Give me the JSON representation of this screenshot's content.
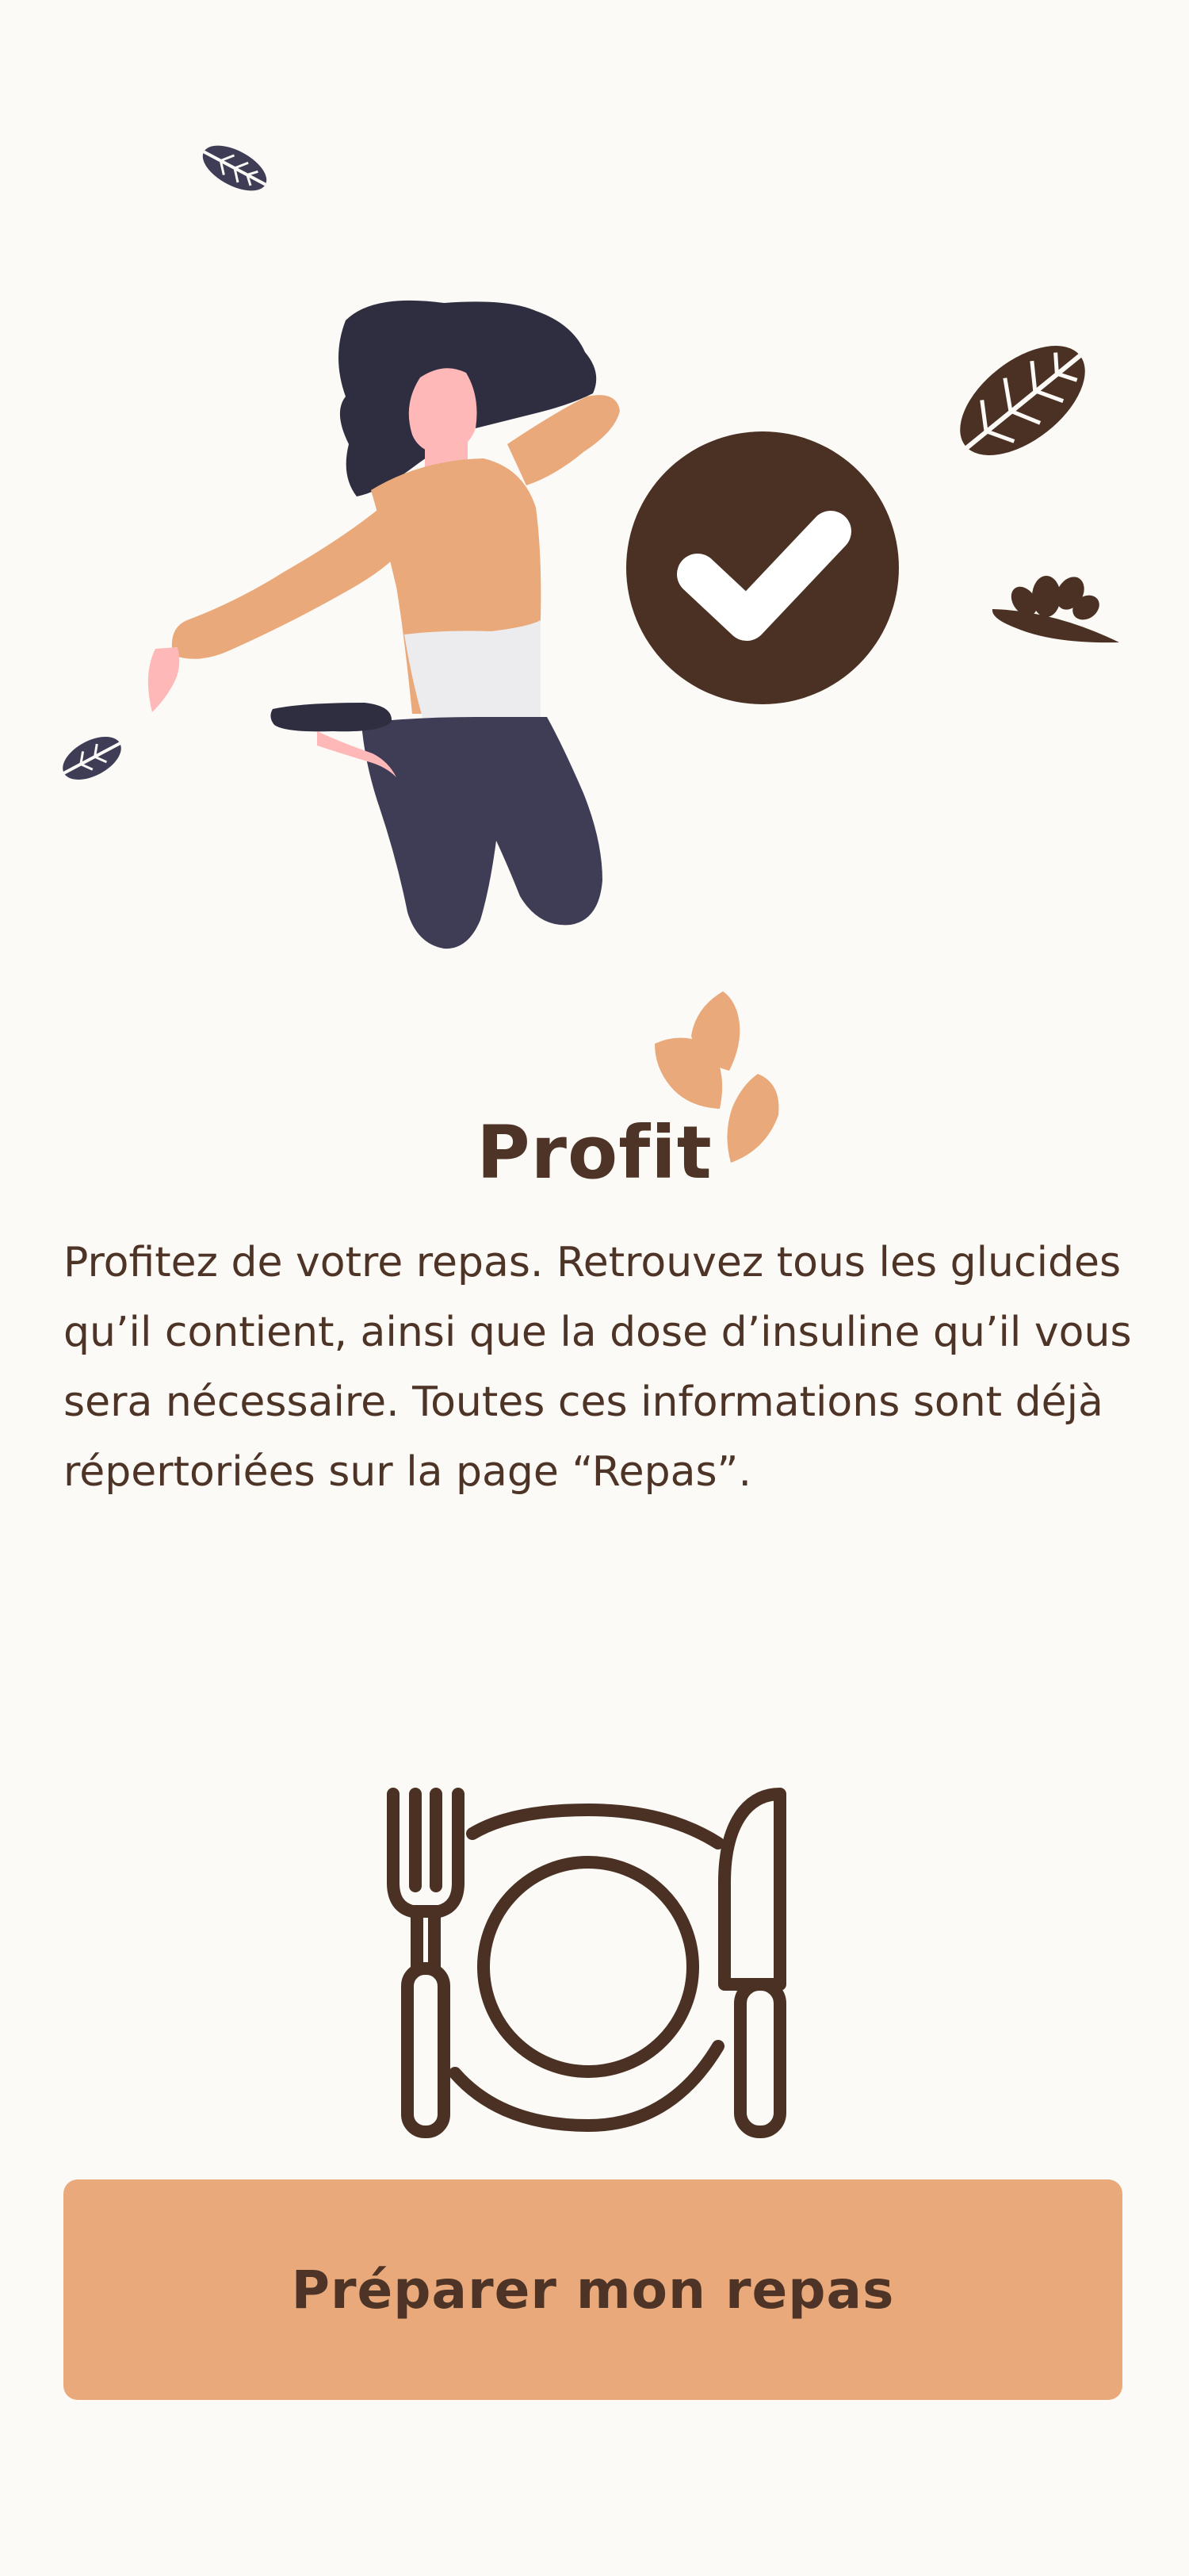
{
  "onboarding": {
    "title": "Profit",
    "description": "Profitez de votre repas. Retrouvez tous les glucides qu’il contient, ainsi que la dose d’insuline qu’il vous sera nécessaire. Toutes ces informations sont déjà répertoriées sur la page “Repas”.",
    "cta_label": "Préparer mon repas"
  },
  "icons": {
    "hero_illustration": "woman-jumping-illustration",
    "check": "check-circle-icon",
    "leaves": "leaf-icon",
    "meal": "plate-fork-knife-icon"
  },
  "colors": {
    "background": "#fcfaf6",
    "primary_text": "#4e3426",
    "accent": "#e9a97a",
    "check_circle": "#4a3123",
    "dark_leaf": "#3f3d56"
  }
}
